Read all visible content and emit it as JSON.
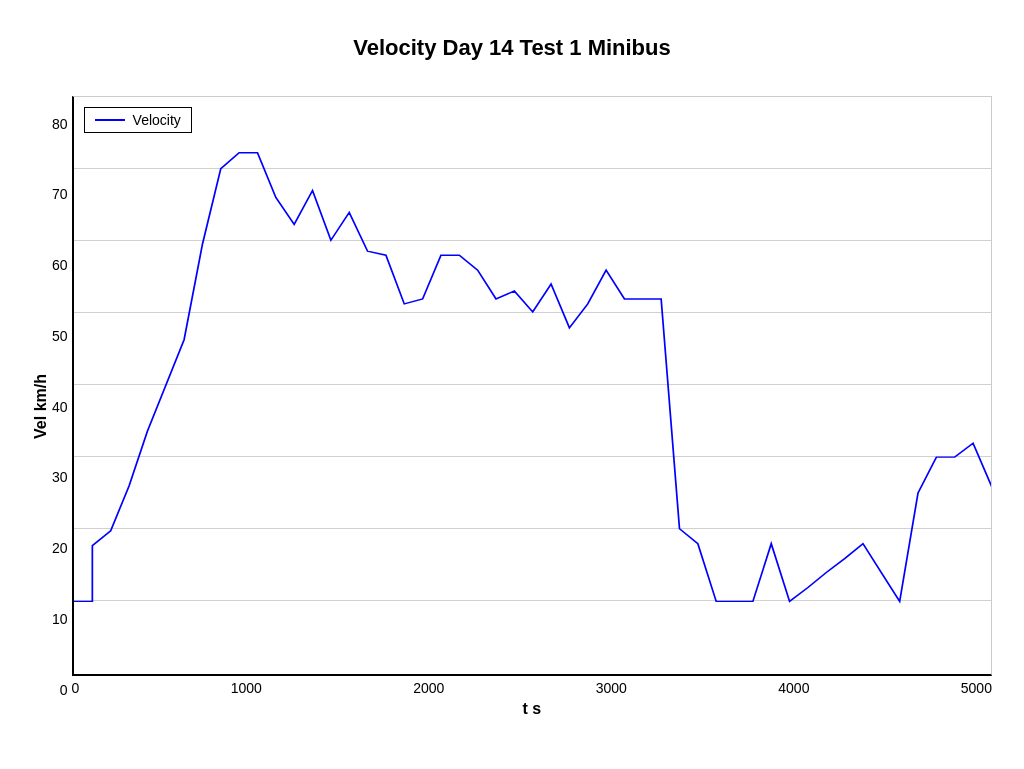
{
  "chart": {
    "title": "Velocity Day 14 Test 1 Minibus",
    "y_axis_label": "Vel km/h",
    "x_axis_label": "t s",
    "legend_label": "Velocity",
    "y_ticks": [
      0,
      10,
      20,
      30,
      40,
      50,
      60,
      70,
      80
    ],
    "x_ticks": [
      0,
      1000,
      2000,
      3000,
      4000,
      5000
    ],
    "x_min": 0,
    "x_max": 5000,
    "y_min": 0,
    "y_max": 80,
    "line_color": "blue"
  }
}
